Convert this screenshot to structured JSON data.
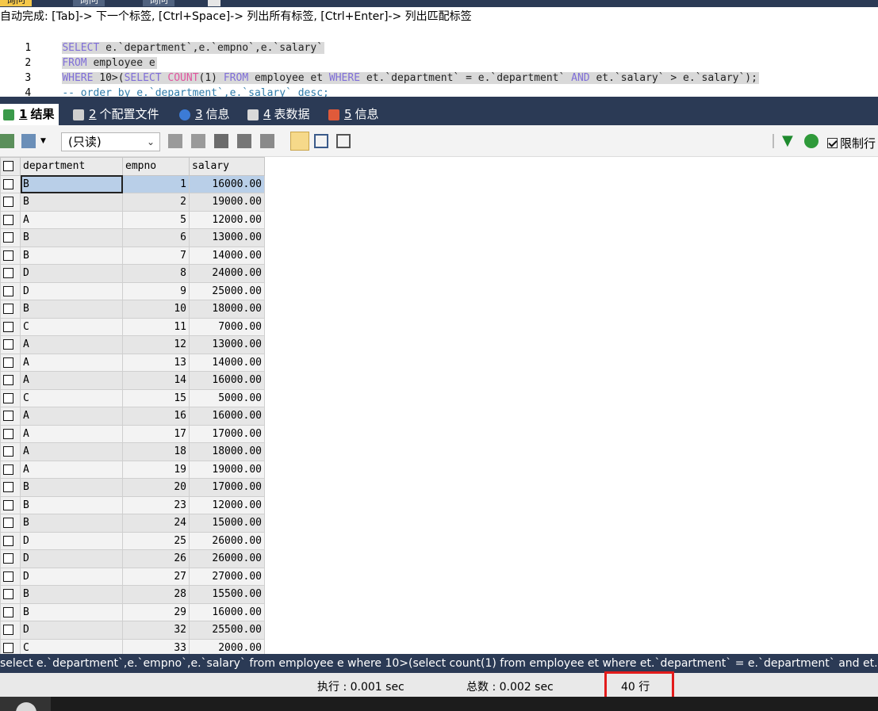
{
  "query_tabs": [
    "询问",
    "询问",
    "询问"
  ],
  "editor": {
    "autocomplete_hint": "自动完成: [Tab]-> 下一个标签, [Ctrl+Space]-> 列出所有标签, [Ctrl+Enter]-> 列出匹配标签",
    "line_numbers": [
      "1",
      "2",
      "3",
      "4"
    ],
    "line1": {
      "kw": "SELECT",
      "rest": " e.`department`,e.`empno`,e.`salary`"
    },
    "line2": {
      "kw": "FROM",
      "rest": " employee e"
    },
    "line3": {
      "kw1": "WHERE",
      "t1": " 10>(",
      "kw2": "SELECT",
      "t2": " ",
      "fn": "COUNT",
      "t3": "(1) ",
      "kw3": "FROM",
      "t4": " employee et ",
      "kw4": "WHERE",
      "t5": " et.`department` = e.`department` ",
      "kw5": "AND",
      "t6": " et.`salary` > e.`salary`);"
    },
    "line4": "-- order by e.`department`,e.`salary` desc;"
  },
  "result_tabs": [
    {
      "num": "1",
      "label": "结果"
    },
    {
      "num": "2",
      "label": "个配置文件"
    },
    {
      "num": "3",
      "label": "信息"
    },
    {
      "num": "4",
      "label": "表数据"
    },
    {
      "num": "5",
      "label": "信息"
    }
  ],
  "toolbar": {
    "readonly_value": "(只读)",
    "limit_rows_label": "限制行"
  },
  "grid": {
    "columns": [
      "department",
      "empno",
      "salary"
    ],
    "rows": [
      [
        "B",
        "1",
        "16000.00"
      ],
      [
        "B",
        "2",
        "19000.00"
      ],
      [
        "A",
        "5",
        "12000.00"
      ],
      [
        "B",
        "6",
        "13000.00"
      ],
      [
        "B",
        "7",
        "14000.00"
      ],
      [
        "D",
        "8",
        "24000.00"
      ],
      [
        "D",
        "9",
        "25000.00"
      ],
      [
        "B",
        "10",
        "18000.00"
      ],
      [
        "C",
        "11",
        "7000.00"
      ],
      [
        "A",
        "12",
        "13000.00"
      ],
      [
        "A",
        "13",
        "14000.00"
      ],
      [
        "A",
        "14",
        "16000.00"
      ],
      [
        "C",
        "15",
        "5000.00"
      ],
      [
        "A",
        "16",
        "16000.00"
      ],
      [
        "A",
        "17",
        "17000.00"
      ],
      [
        "A",
        "18",
        "18000.00"
      ],
      [
        "A",
        "19",
        "19000.00"
      ],
      [
        "B",
        "20",
        "17000.00"
      ],
      [
        "B",
        "23",
        "12000.00"
      ],
      [
        "B",
        "24",
        "15000.00"
      ],
      [
        "D",
        "25",
        "26000.00"
      ],
      [
        "D",
        "26",
        "26000.00"
      ],
      [
        "D",
        "27",
        "27000.00"
      ],
      [
        "B",
        "28",
        "15500.00"
      ],
      [
        "B",
        "29",
        "16000.00"
      ],
      [
        "D",
        "32",
        "25500.00"
      ],
      [
        "C",
        "33",
        "2000.00"
      ]
    ]
  },
  "status": {
    "sql_text": "select e.`department`,e.`empno`,e.`salary` from employee e where 10>(select count(1) from employee et where et.`department` = e.`department` and et.`salary` > e.`salary`);",
    "exec_time": "执行 : 0.001 sec",
    "total_time": "总数 : 0.002 sec",
    "row_count": "40 行"
  },
  "colors": {
    "dark_navy": "#2b3a55",
    "keyword": "#7f6ed8",
    "function": "#e0559e",
    "comment": "#2e7aa8",
    "highlight_box": "#e21b1b"
  }
}
